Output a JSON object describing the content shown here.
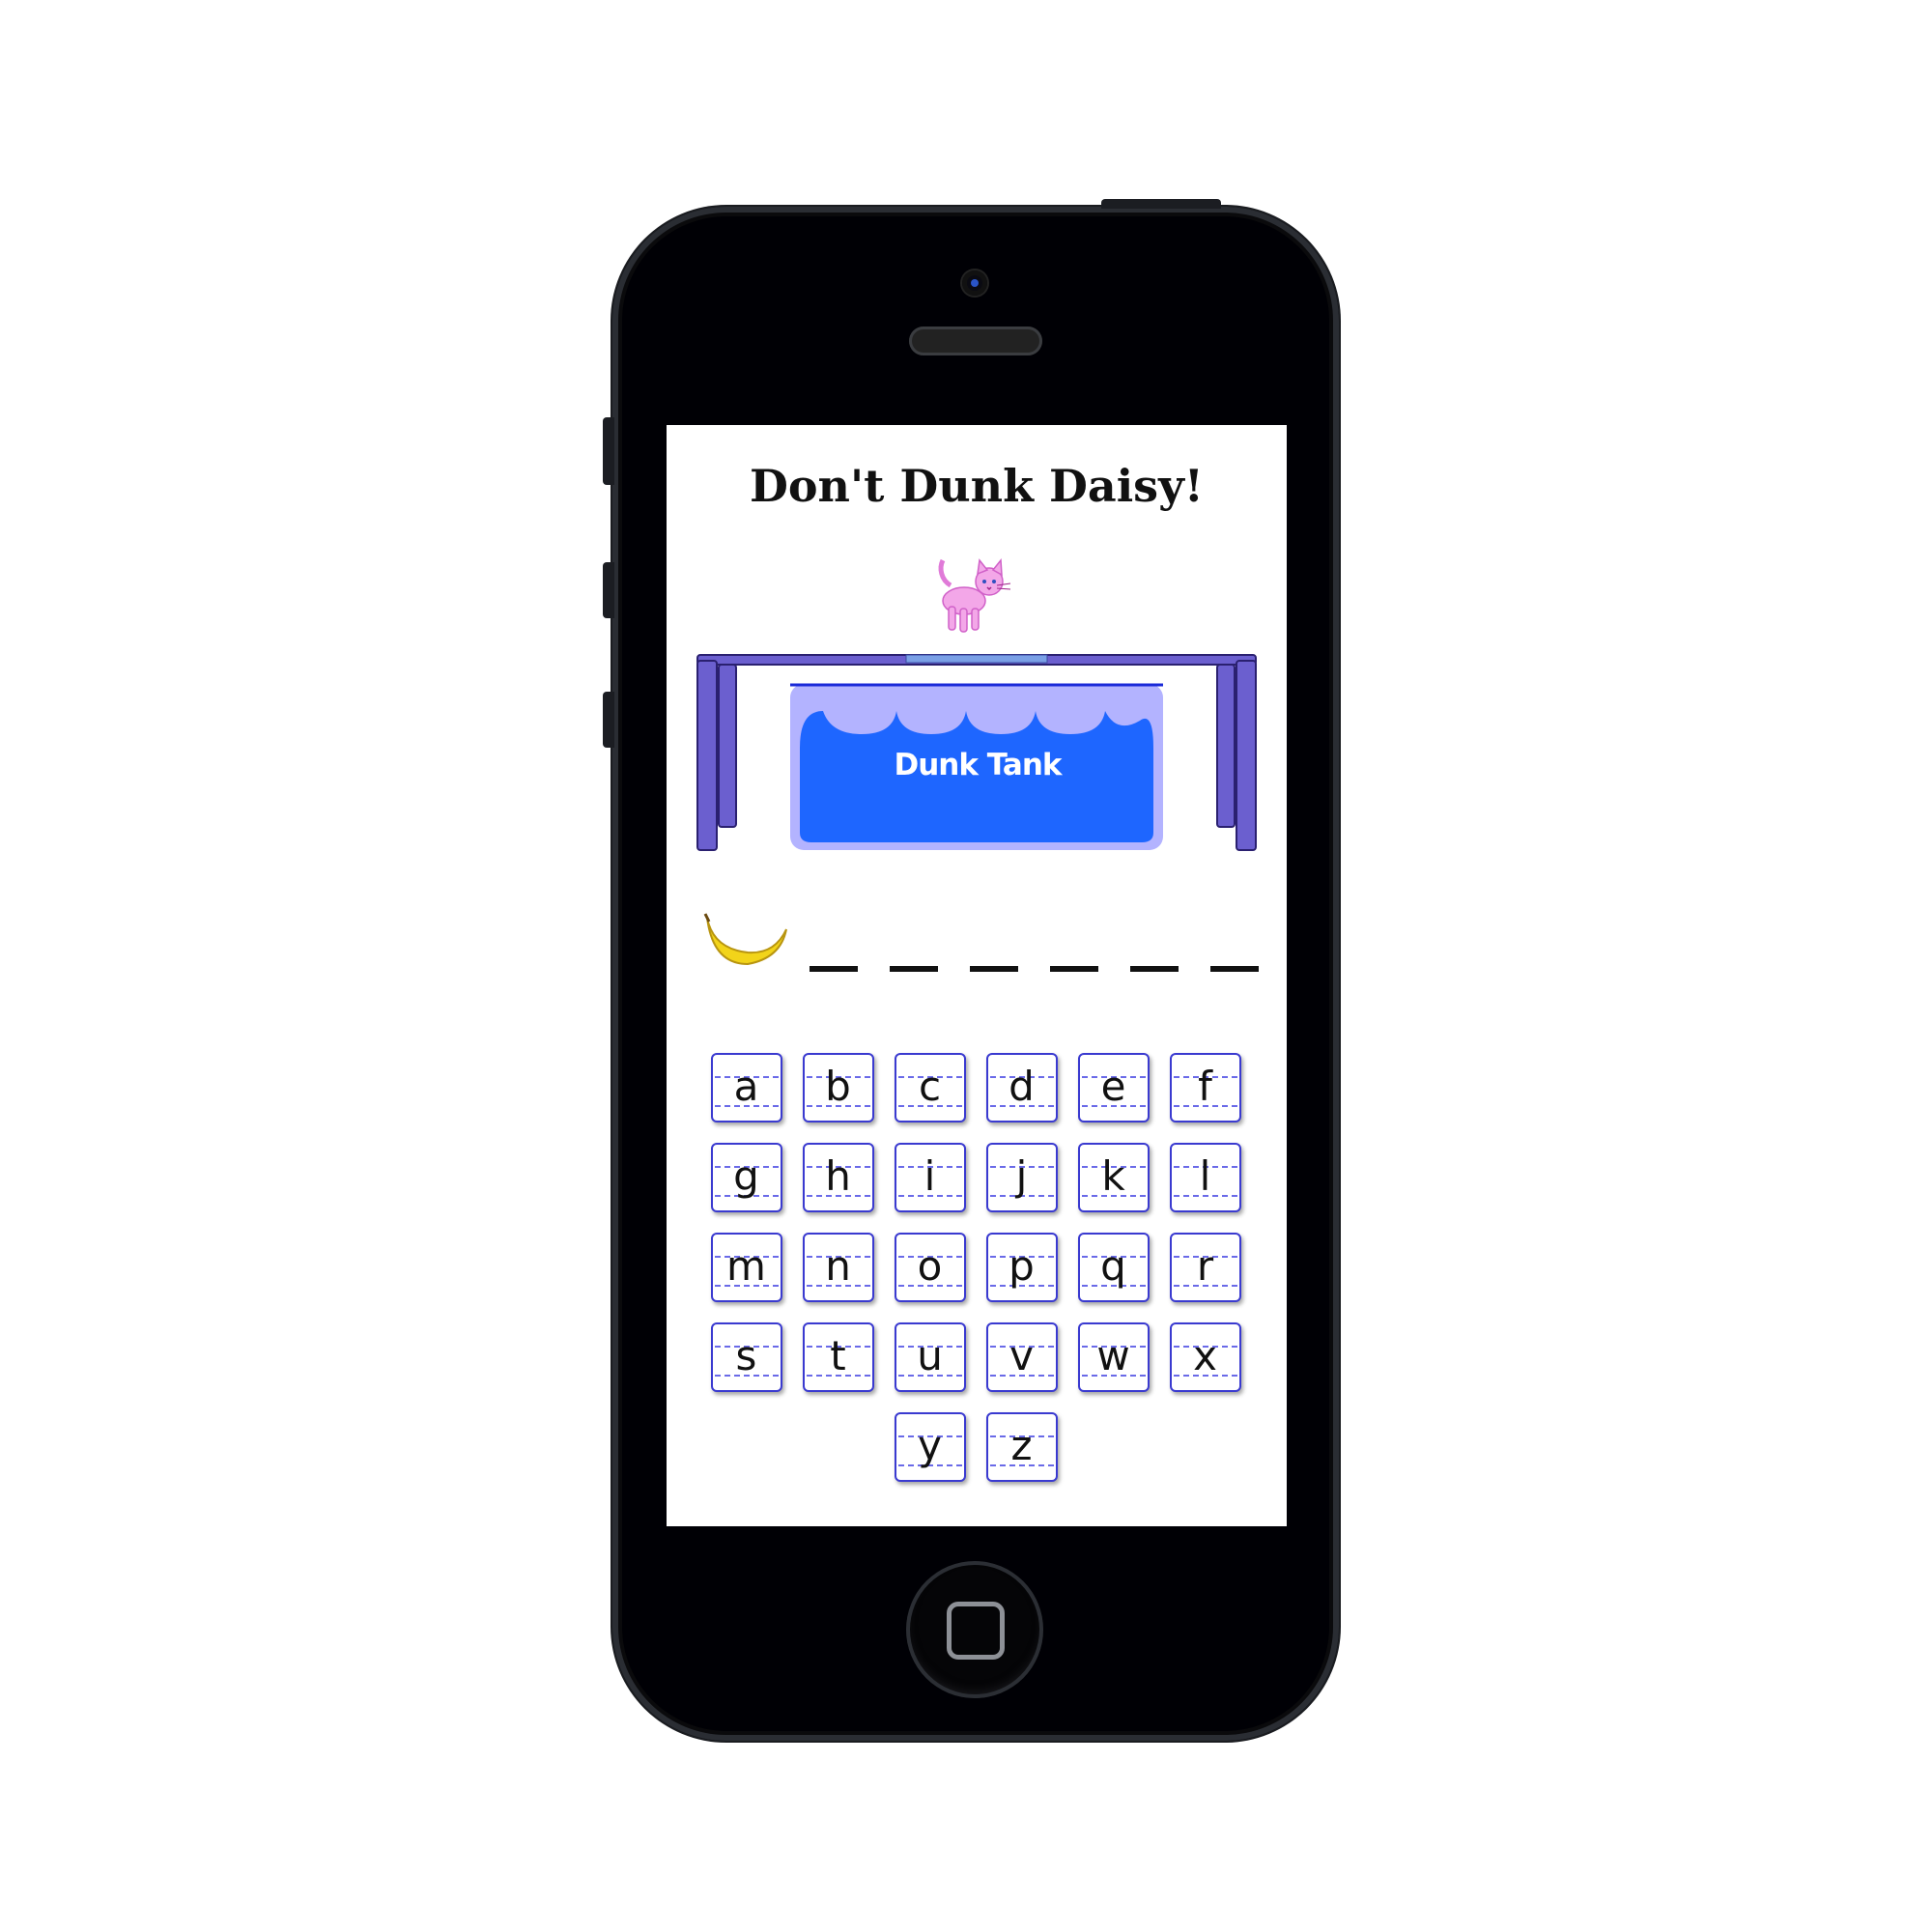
{
  "game": {
    "title": "Don't Dunk Daisy!",
    "tank_label": "Dunk Tank",
    "word_blanks": 6,
    "hint_icon": "banana-icon"
  },
  "keyboard": {
    "rows": [
      [
        "a",
        "b",
        "c",
        "d",
        "e",
        "f"
      ],
      [
        "g",
        "h",
        "i",
        "j",
        "k",
        "l"
      ],
      [
        "m",
        "n",
        "o",
        "p",
        "q",
        "r"
      ],
      [
        "s",
        "t",
        "u",
        "v",
        "w",
        "x"
      ],
      [
        "y",
        "z"
      ]
    ]
  },
  "colors": {
    "stand": "#6b5fcf",
    "tank_water": "#1e66ff",
    "tank_light": "#b3b3ff",
    "key_border": "#3a3ad0"
  }
}
